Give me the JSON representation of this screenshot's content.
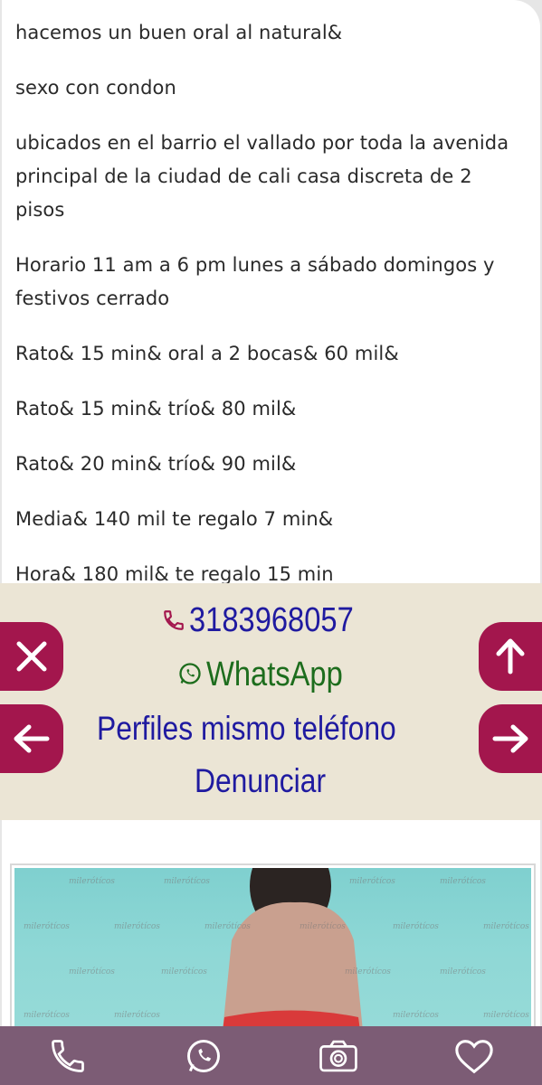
{
  "description": {
    "paragraphs": [
      "hacemos un buen oral al natural&",
      "sexo con condon",
      "ubicados en el barrio el vallado por toda la avenida principal de la ciudad de cali casa discreta de 2 pisos",
      "Horario 11 am a 6 pm lunes a sábado domingos y festivos cerrado",
      "Rato& 15 min& oral a 2 bocas& 60 mil&",
      "Rato& 15 min& trío& 80 mil&",
      "Rato& 20 min& trío& 90 mil&",
      "Media& 140 mil te regalo 7 min&",
      "Hora& 180 mil& te regalo 15 min"
    ]
  },
  "contact": {
    "phone": "3183968057",
    "whatsapp_label": "WhatsApp",
    "same_phone_profiles": "Perfiles mismo teléfono",
    "report": "Denunciar"
  },
  "photo": {
    "watermark": "milerótícos"
  },
  "colors": {
    "accent": "#a3164d",
    "bottom_bar": "#7c5c75",
    "contact_band": "#ebe5d5",
    "link_blue": "#1f1aa0",
    "whatsapp_green": "#1d6d1d"
  },
  "icons": {
    "side_left_top": "close-icon",
    "side_left_bottom": "arrow-left-icon",
    "side_right_top": "arrow-up-icon",
    "side_right_bottom": "arrow-right-icon",
    "bottom_bar": [
      "phone-icon",
      "whatsapp-icon",
      "camera-icon",
      "heart-icon"
    ]
  }
}
